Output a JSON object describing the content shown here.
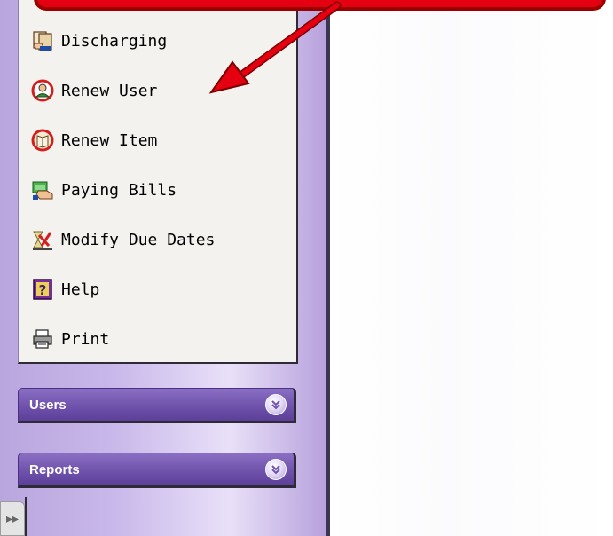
{
  "menu": {
    "items": [
      {
        "label": "Discharging",
        "icon": "discharging-icon"
      },
      {
        "label": "Renew User",
        "icon": "renew-user-icon"
      },
      {
        "label": "Renew Item",
        "icon": "renew-item-icon"
      },
      {
        "label": "Paying Bills",
        "icon": "paying-bills-icon"
      },
      {
        "label": "Modify Due Dates",
        "icon": "modify-due-dates-icon"
      },
      {
        "label": "Help",
        "icon": "help-icon"
      },
      {
        "label": "Print",
        "icon": "print-icon"
      }
    ]
  },
  "sections": [
    {
      "label": "Users"
    },
    {
      "label": "Reports"
    }
  ],
  "collapse": {
    "symbol": "▸▸"
  },
  "colors": {
    "callout": "#e40010",
    "section_header": "#6f52ab",
    "menu_panel": "#f4f2ee"
  }
}
